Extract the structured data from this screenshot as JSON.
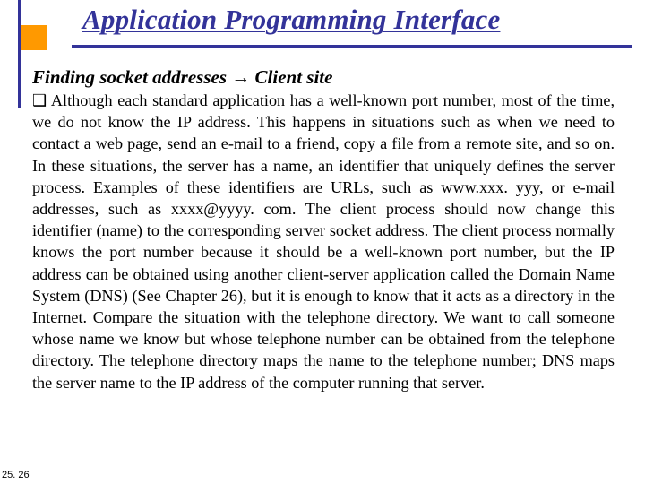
{
  "title": "Application Programming Interface",
  "subtitle_prefix": "Finding socket addresses ",
  "subtitle_arrow": "→",
  "subtitle_suffix": " Client site",
  "bullet": "❑",
  "paragraph": " Although each standard application has a well-known port number, most of the time, we do not know the IP address. This happens in situations such as when we  need to contact a web page, send an e-mail to a friend, copy a file from a remote site, and so on. In these situations, the server has a name, an identifier that uniquely defines the server process. Examples of these identifiers are URLs, such as www.xxx. yyy, or e-mail addresses, such as xxxx@yyyy. com. The client process should now change this identifier (name) to the corresponding server socket address. The client process normally knows the port number because it should be a well-known port number, but the IP address can be obtained using another client-server application called the Domain Name System (DNS) (See Chapter 26), but it is enough to know that it acts as a directory in the Internet. Compare the situation with the telephone directory. We want to call someone whose name we know but whose telephone number can be obtained from the telephone directory. The telephone directory maps the name to the telephone number; DNS maps the server name to the IP address of the computer running that server.",
  "page_number": "25. 26"
}
